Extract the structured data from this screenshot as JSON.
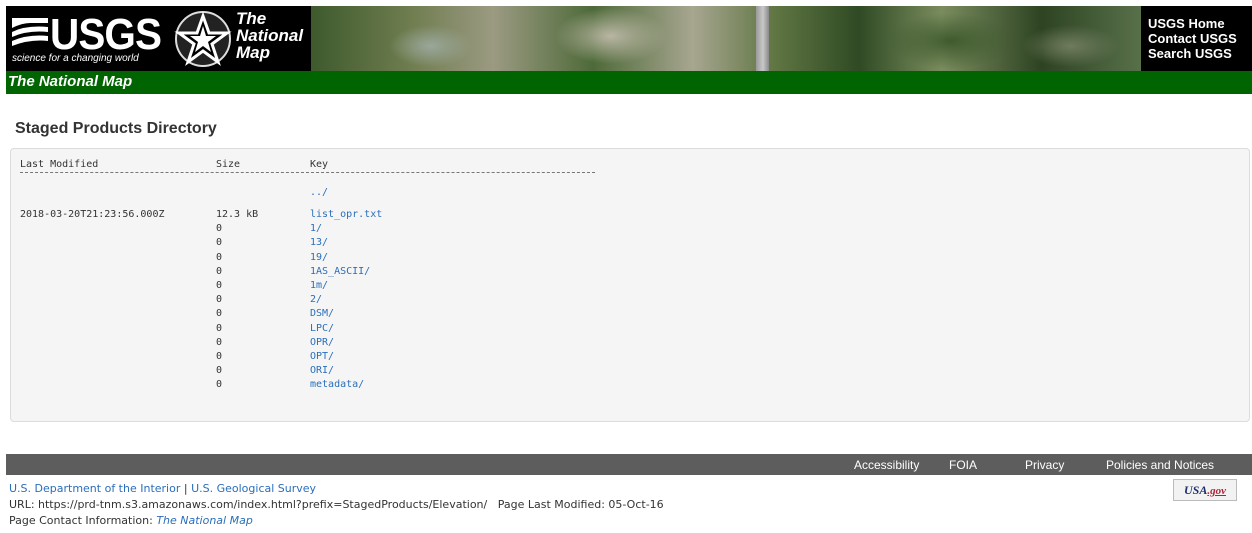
{
  "header": {
    "usgs_word": "USGS",
    "usgs_tagline": "science for a changing world",
    "tnm_line1": "The",
    "tnm_line2": "National",
    "tnm_line3": "Map",
    "links": [
      "USGS Home",
      "Contact USGS",
      "Search USGS"
    ]
  },
  "site_bar": {
    "title": "The National Map"
  },
  "page": {
    "heading": "Staged Products Directory"
  },
  "listing": {
    "headers": {
      "date": "Last Modified",
      "size": "Size",
      "key": "Key"
    },
    "parent": "../",
    "rows": [
      {
        "date": "2018-03-20T21:23:56.000Z",
        "size": "12.3 kB",
        "key": "list_opr.txt"
      },
      {
        "date": "",
        "size": "0",
        "key": "1/"
      },
      {
        "date": "",
        "size": "0",
        "key": "13/"
      },
      {
        "date": "",
        "size": "0",
        "key": "19/"
      },
      {
        "date": "",
        "size": "0",
        "key": "1AS_ASCII/"
      },
      {
        "date": "",
        "size": "0",
        "key": "1m/"
      },
      {
        "date": "",
        "size": "0",
        "key": "2/"
      },
      {
        "date": "",
        "size": "0",
        "key": "DSM/"
      },
      {
        "date": "",
        "size": "0",
        "key": "LPC/"
      },
      {
        "date": "",
        "size": "0",
        "key": "OPR/"
      },
      {
        "date": "",
        "size": "0",
        "key": "OPT/"
      },
      {
        "date": "",
        "size": "0",
        "key": "ORI/"
      },
      {
        "date": "",
        "size": "0",
        "key": "metadata/"
      }
    ]
  },
  "footer": {
    "nav": [
      "Accessibility",
      "FOIA",
      "Privacy",
      "Policies and Notices"
    ],
    "doi_link": "U.S. Department of the Interior",
    "divider": "|",
    "usgs_link": "U.S. Geological Survey",
    "url_line": "URL: https://prd-tnm.s3.amazonaws.com/index.html?prefix=StagedProducts/Elevation/",
    "modified_line": "Page Last Modified: 05-Oct-16",
    "contact_label": "Page Contact Information:",
    "contact_link": "The National Map",
    "badge_usa": "USA",
    "badge_gov": ".gov"
  },
  "colors": {
    "site_bar": "#006400",
    "footer_bar": "#5d5d5d",
    "link": "#2a6ebb"
  }
}
